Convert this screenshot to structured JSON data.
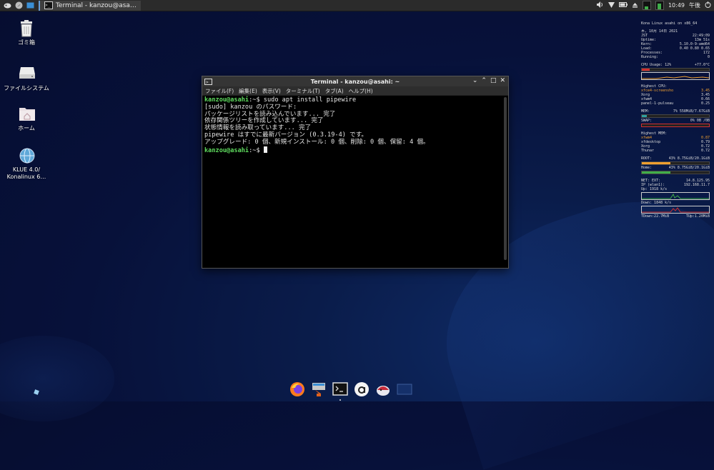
{
  "taskbar": {
    "active_window_label": "Terminal - kanzou@asa…",
    "clock": "10:49",
    "ampm": "午後"
  },
  "desktop_icons": [
    {
      "label": "ゴミ箱",
      "icon": "trash-icon"
    },
    {
      "label": "ファイルシステム",
      "icon": "drive-icon"
    },
    {
      "label": "ホーム",
      "icon": "home-folder-icon"
    },
    {
      "label": "KLUE 4.0/ Konalinux 6…",
      "icon": "globe-icon"
    }
  ],
  "terminal": {
    "title": "Terminal - kanzou@asahi: ~",
    "menu": [
      "ファイル(F)",
      "編集(E)",
      "表示(V)",
      "ターミナル(T)",
      "タブ(A)",
      "ヘルプ(H)"
    ],
    "prompt": "kanzou@asahi",
    "prompt_suffix": ":~$",
    "command": " sudo apt install pipewire",
    "output": [
      "[sudo] kanzou のパスワード:",
      "パッケージリストを読み込んでいます... 完了",
      "依存関係ツリーを作成しています... 完了",
      "状態情報を読み取っています... 完了",
      "pipewire はすでに最新バージョン (0.3.19-4) です。",
      "アップグレード: 0 個、新規インストール: 0 個、削除: 0 個、保留: 4 個。"
    ]
  },
  "conky": {
    "header": "Kona Linux asahi on x86_64",
    "date": "木, 10月 14日 2021",
    "time_label": "JST",
    "time": "22:49:09",
    "uptime_label": "Uptime:",
    "uptime": "13m 51s",
    "kern_label": "Kern:",
    "kern": "5.10.0-9-amd64",
    "load_label": "Load:",
    "load": "0.40 0.80 0.65",
    "procs_label": "Processes:",
    "procs": "172",
    "running_label": "Running:",
    "running": "0",
    "cpu_label": "CPU Usage: 12%",
    "cpu_temp": "+77.0°C",
    "highest_cpu_label": "Highest CPU:",
    "cpu_procs": [
      {
        "name": "xfce4-screensho",
        "val": "3.45"
      },
      {
        "name": "Xorg",
        "val": "3.45"
      },
      {
        "name": "xfwm4",
        "val": "0.66"
      },
      {
        "name": "panel-1-pulseau",
        "val": "0.25"
      }
    ],
    "mem_label": "MEM:",
    "mem": "7% 558MiB/7.67GiB",
    "mem_fraction": 0.07,
    "swap_label": "SWAP:",
    "swap": "0% 0B /0B",
    "highest_mem_label": "Highest MEM:",
    "mem_procs": [
      {
        "name": "xfwm4",
        "val": "0.87"
      },
      {
        "name": "xfdesktop",
        "val": "0.79"
      },
      {
        "name": "Xorg",
        "val": "0.72"
      },
      {
        "name": "Thunar",
        "val": "0.72"
      }
    ],
    "root_label": "ROOT:",
    "root": "43% 8.75GiB/20.1GiB",
    "root_fraction": 0.43,
    "home_label": "Home:",
    "home": "43% 8.75GiB/20.1GiB",
    "home_fraction": 0.43,
    "net_label": "NET: EXT:",
    "net_ext": "14.8.125.95",
    "ip_label": "IP (wlan1):",
    "ip": "192.168.11.7",
    "up_label": "Up: 1918   k/s",
    "down_label": "Down: 1848   k/s",
    "tdown": "TDown:22.7MiB",
    "tup": "TUp:1.20MiB",
    "accent_orange": "#f0a030",
    "accent_red": "#d03030",
    "accent_green": "#3fae4a"
  }
}
